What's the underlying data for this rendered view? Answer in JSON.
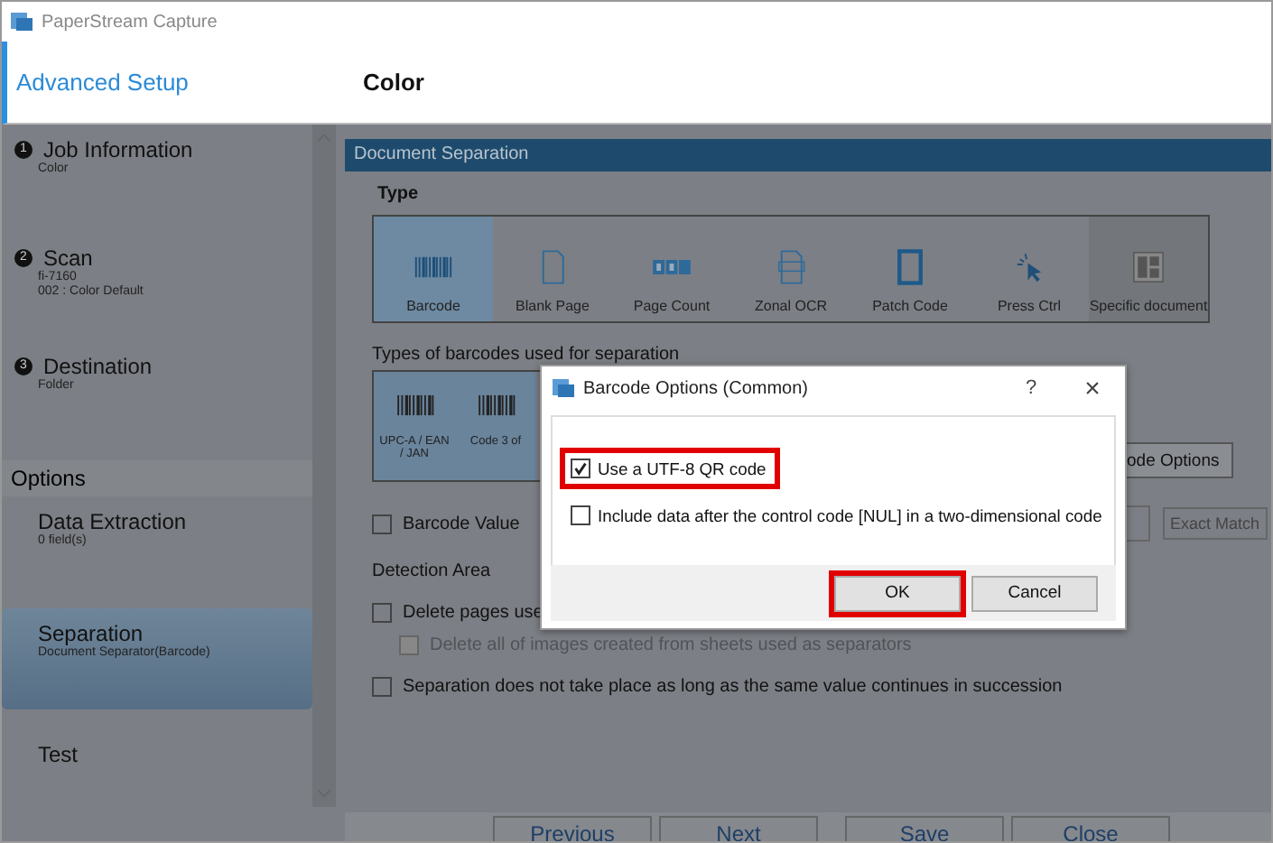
{
  "app": {
    "title": "PaperStream Capture"
  },
  "header": {
    "section": "Advanced Setup",
    "page": "Color"
  },
  "sidebar": {
    "steps": [
      {
        "number": "1",
        "title": "Job Information",
        "details": [
          "Color"
        ],
        "selected": false
      },
      {
        "number": "2",
        "title": "Scan",
        "details": [
          "fi-7160",
          "002 : Color Default"
        ],
        "selected": false
      },
      {
        "number": "3",
        "title": "Destination",
        "details": [
          "Folder"
        ],
        "selected": false
      }
    ],
    "options_heading": "Options",
    "options": [
      {
        "title": "Data Extraction",
        "details": [
          "0 field(s)"
        ],
        "selected": false
      },
      {
        "title": "Separation",
        "details": [
          "Document Separator(Barcode)"
        ],
        "selected": true
      },
      {
        "title": "Test",
        "selected": false
      }
    ]
  },
  "main": {
    "section_title": "Document Separation",
    "type_label": "Type",
    "types": [
      {
        "kind": "barcode",
        "label": "Barcode",
        "selected": true
      },
      {
        "kind": "blank",
        "label": "Blank Page",
        "selected": false
      },
      {
        "kind": "count",
        "label": "Page Count",
        "selected": false
      },
      {
        "kind": "ocr",
        "label": "Zonal OCR",
        "selected": false
      },
      {
        "kind": "patch",
        "label": "Patch Code",
        "selected": false
      },
      {
        "kind": "press",
        "label": "Press Ctrl",
        "selected": false
      },
      {
        "kind": "specific",
        "label": "Specific document",
        "selected": false
      }
    ],
    "barcode_types_label": "Types of barcodes used for separation",
    "barcode_types": [
      {
        "label": "UPC-A / EAN / JAN",
        "selected": true
      },
      {
        "label": "Code 3 of",
        "selected": true
      }
    ],
    "options_button": "ode Options",
    "barcode_value": {
      "label": "Barcode Value",
      "checked": false
    },
    "match_mode": "Exact Match",
    "detection_area_label": "Detection Area",
    "checks": [
      {
        "label": "Delete pages use",
        "checked": false,
        "disabled": false,
        "children": [
          {
            "label": "Delete all of images created from sheets used as separators",
            "checked": false,
            "disabled": true
          }
        ]
      },
      {
        "label": "Separation does not take place as long as the same value continues in succession",
        "checked": false,
        "disabled": false
      }
    ]
  },
  "footer": {
    "buttons": [
      "Previous",
      "Next",
      "Save",
      "Close"
    ]
  },
  "dialog": {
    "title": "Barcode Options (Common)",
    "help": "?",
    "close": "×",
    "options": [
      {
        "label": "Use a UTF-8 QR code",
        "checked": true,
        "highlighted": true
      },
      {
        "label": "Include data after the control code [NUL] in a two-dimensional code",
        "checked": false,
        "highlighted": false
      }
    ],
    "buttons": [
      {
        "label": "OK",
        "highlighted": true
      },
      {
        "label": "Cancel",
        "highlighted": false
      }
    ]
  }
}
